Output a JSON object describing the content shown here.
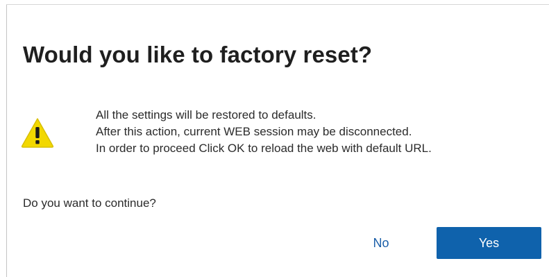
{
  "dialog": {
    "title": "Would you like to factory reset?",
    "warning_icon": "warning-triangle-icon",
    "message_lines": [
      "All the settings will be restored to defaults.",
      "After this action, current WEB session may be disconnected.",
      "In order to proceed Click OK to reload the web with default URL."
    ],
    "question": "Do you want to continue?",
    "no_label": "No",
    "yes_label": "Yes"
  },
  "colors": {
    "primary_button": "#0f62ac",
    "link_button": "#1a5ea8",
    "warning_fill": "#f2d800"
  }
}
